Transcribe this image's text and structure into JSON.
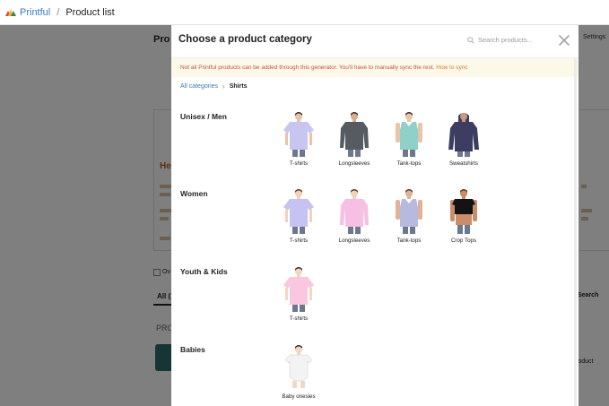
{
  "topbar": {
    "brand": "Printful",
    "separator": "/",
    "current": "Product list"
  },
  "background": {
    "page_title_fragment": "Pro",
    "settings_fragment": "Settings",
    "heading_fragment": "He",
    "checkbox_label_fragment": "Ov",
    "tab_fragment": "All (1",
    "search_fragment": "Search",
    "products_fragment": "PRO",
    "product_fragment": "roduct"
  },
  "modal": {
    "title": "Choose a product category",
    "search_placeholder": "Search products...",
    "notice_text": "Not all Printful products can be added through this generator. You'll have to manually sync the rest. ",
    "notice_link": "How to sync",
    "breadcrumb_root": "All categories",
    "breadcrumb_current": "Shirts",
    "sections": [
      {
        "title": "Unisex / Men",
        "items": [
          {
            "label": "T-shirts",
            "type": "tshirt",
            "color": "#c8c6f1",
            "skin": "#e8c4a8"
          },
          {
            "label": "Longsleeves",
            "type": "longsleeve",
            "color": "#555b60",
            "skin": "#d8ac8e"
          },
          {
            "label": "Tank-tops",
            "type": "tank",
            "color": "#8fd0c9",
            "skin": "#e8c4a8"
          },
          {
            "label": "Sweatshirts",
            "type": "hoodie",
            "color": "#3c3d60",
            "skin": "#c99a7c"
          }
        ]
      },
      {
        "title": "Women",
        "items": [
          {
            "label": "T-shirts",
            "type": "tshirt-w",
            "color": "#c6c2f2",
            "skin": "#f0d2bd"
          },
          {
            "label": "Longsleeves",
            "type": "longsleeve-w",
            "color": "#f7bfe3",
            "skin": "#f0d2bd"
          },
          {
            "label": "Tank-tops",
            "type": "tank-w",
            "color": "#b8b9de",
            "skin": "#dfb398"
          },
          {
            "label": "Crop Tops",
            "type": "crop",
            "color": "#131313",
            "skin": "#c98d6a"
          }
        ]
      },
      {
        "title": "Youth & Kids",
        "items": [
          {
            "label": "T-shirts",
            "type": "kid",
            "color": "#f9c7de",
            "skin": "#f3d7c2"
          }
        ]
      },
      {
        "title": "Babies",
        "items": [
          {
            "label": "Baby onesies",
            "type": "onesie",
            "color": "#f3f3f3",
            "skin": "#f3d7c2"
          }
        ]
      }
    ]
  },
  "colors": {
    "brand_blue": "#3a7bbf",
    "notice_bg": "#fdf9e8",
    "notice_text": "#c0504a",
    "notice_link": "#d77a32",
    "overlay": "rgba(0,0,0,0.5)"
  }
}
